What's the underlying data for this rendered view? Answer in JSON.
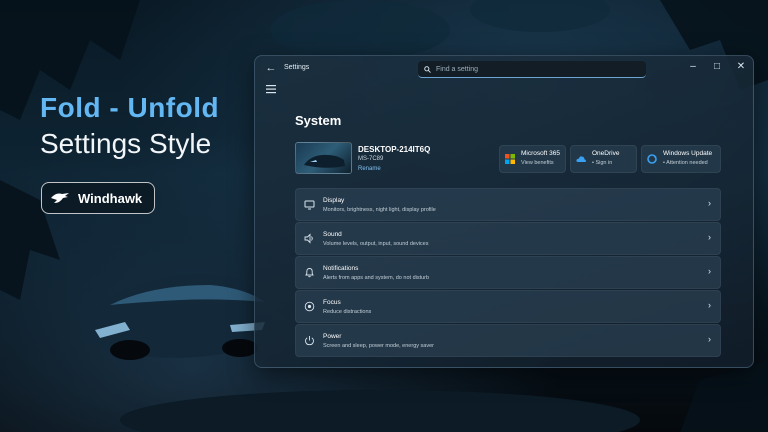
{
  "promo": {
    "title": "Fold - Unfold",
    "subtitle": "Settings Style",
    "badge_label": "Windhawk"
  },
  "window": {
    "app_title": "Settings",
    "search_placeholder": "Find a setting",
    "page_title": "System",
    "device": {
      "name": "DESKTOP-214IT6Q",
      "model": "MS-7C89",
      "rename_label": "Rename"
    },
    "quick_cards": [
      {
        "title": "Microsoft 365",
        "subtitle": "View benefits",
        "icon": "microsoft-365-icon"
      },
      {
        "title": "OneDrive",
        "subtitle": "• Sign in",
        "icon": "onedrive-icon"
      },
      {
        "title": "Windows Update",
        "subtitle": "• Attention needed",
        "icon": "windows-update-icon"
      }
    ],
    "items": [
      {
        "title": "Display",
        "desc": "Monitors, brightness, night light, display profile",
        "icon": "monitor-icon"
      },
      {
        "title": "Sound",
        "desc": "Volume levels, output, input, sound devices",
        "icon": "speaker-icon"
      },
      {
        "title": "Notifications",
        "desc": "Alerts from apps and system, do not disturb",
        "icon": "bell-icon"
      },
      {
        "title": "Focus",
        "desc": "Reduce distractions",
        "icon": "focus-icon"
      },
      {
        "title": "Power",
        "desc": "Screen and sleep, power mode, energy saver",
        "icon": "power-icon"
      }
    ]
  },
  "colors": {
    "accent": "#63b7f2",
    "link": "#7fc0ef"
  }
}
